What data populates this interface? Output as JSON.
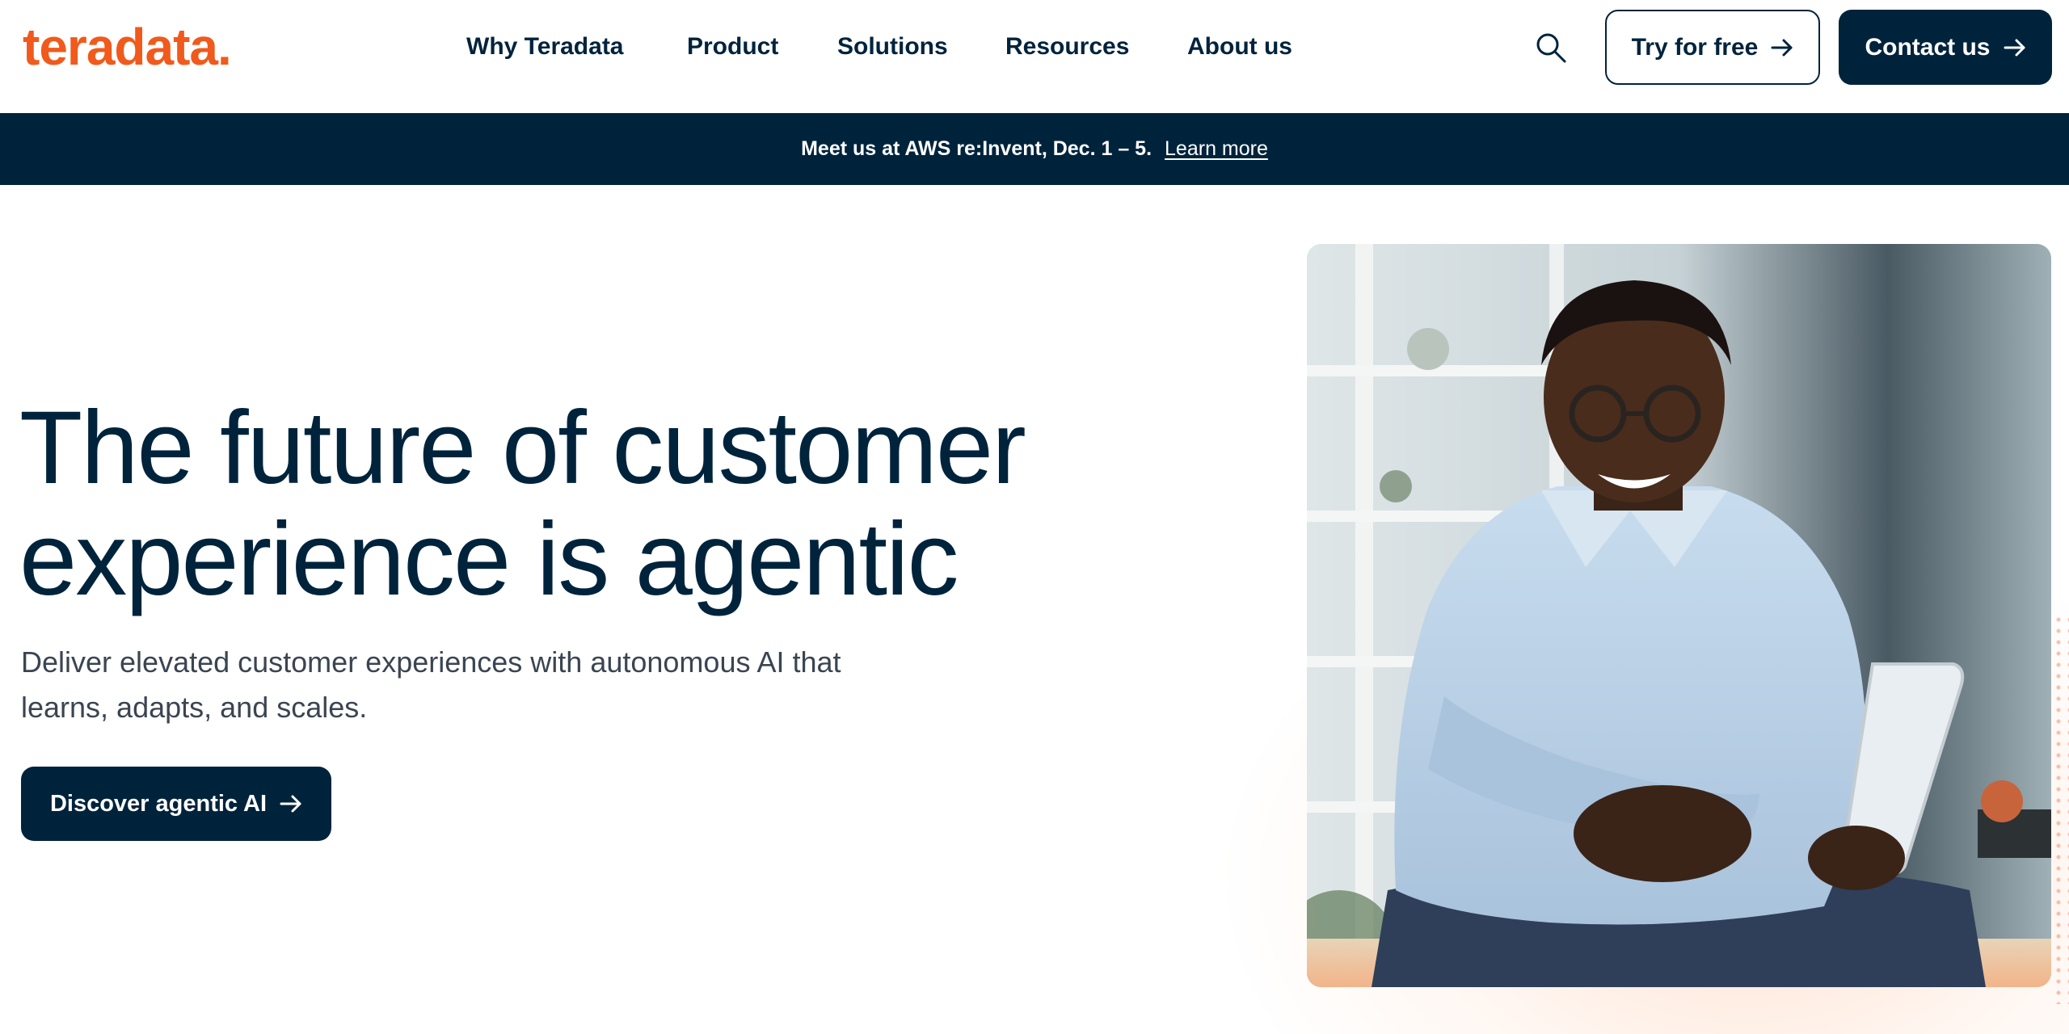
{
  "header": {
    "logo_text": "teradata.",
    "nav": [
      {
        "label": "Why Teradata"
      },
      {
        "label": "Product"
      },
      {
        "label": "Solutions"
      },
      {
        "label": "Resources"
      },
      {
        "label": "About us"
      }
    ],
    "search_icon": "search-icon",
    "try_free_label": "Try for free",
    "contact_label": "Contact us"
  },
  "banner": {
    "message": "Meet us at AWS re:Invent, Dec. 1 – 5.",
    "link_label": "Learn more"
  },
  "hero": {
    "title_line1": "The future of customer",
    "title_line2": "experience is agentic",
    "subtitle_line1": "Deliver elevated customer experiences with autonomous AI that",
    "subtitle_line2": "learns, adapts, and scales.",
    "cta_label": "Discover agentic AI",
    "image": "photo-smiling-man-with-tablet"
  },
  "colors": {
    "brand_orange": "#f05a1c",
    "navy": "#00233c",
    "white": "#ffffff"
  }
}
